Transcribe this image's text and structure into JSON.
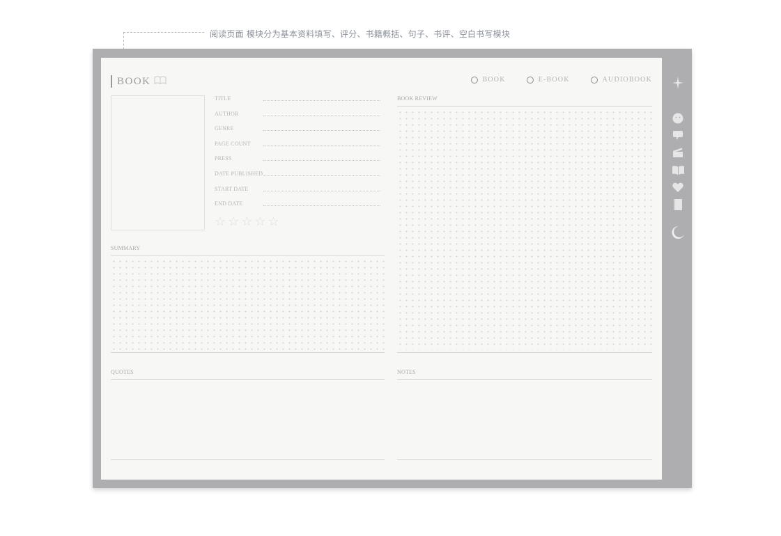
{
  "caption": "阅读页面 模块分为基本资料填写、评分、书籍概括、句子、书评、空白书写模块",
  "page": {
    "title": "BOOK",
    "type_options": [
      "BOOK",
      "E-BOOK",
      "AUDIOBOOK"
    ],
    "fields": [
      "TITLE",
      "AUTHOR",
      "GENRE",
      "PAGE COUNT",
      "PRESS",
      "DATE PUBLISHED",
      "START DATE",
      "END DATE"
    ],
    "rating": {
      "value": 0,
      "max": 5
    },
    "sections": {
      "summary": "SUMMARY",
      "book_review": "BOOK REVIEW",
      "quotes": "QUOTES",
      "notes": "NOTES"
    }
  },
  "sidebar_icons": [
    "sparkle-icon",
    "face-icon",
    "speech-bubble-icon",
    "clapperboard-icon",
    "open-book-icon",
    "heart-icon",
    "notebook-icon",
    "moon-icon"
  ],
  "colors": {
    "frame": "#aeaeb0",
    "page": "#f7f7f5",
    "caption": "#8a8f99",
    "icon": "#e6e6e6"
  }
}
